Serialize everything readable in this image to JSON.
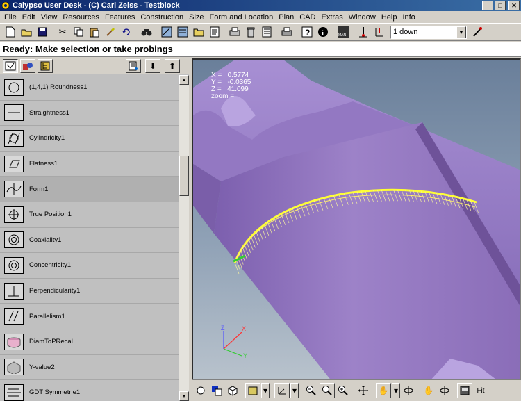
{
  "window": {
    "title": "Calypso User Desk - (C) Carl Zeiss - Testblock",
    "controls": {
      "minimize": "_",
      "maximize": "□",
      "close": "✕"
    }
  },
  "menu": [
    "File",
    "Edit",
    "View",
    "Resources",
    "Features",
    "Construction",
    "Size",
    "Form and Location",
    "Plan",
    "CAD",
    "Extras",
    "Window",
    "Help",
    "Info"
  ],
  "toolbar": {
    "icons": [
      "new-icon",
      "open-icon",
      "save-icon",
      "cut-icon",
      "copy-icon",
      "paste-icon",
      "brush-icon",
      "undo-icon",
      "binoculars-icon",
      "wizard-icon",
      "wizard2-icon",
      "folder-icon",
      "print-icon",
      "delete-icon",
      "report-icon",
      "printer2-icon",
      "help-icon",
      "info-icon",
      "manual-icon",
      "probe-icon",
      "probe-axis-icon"
    ],
    "combo_value": "1 down"
  },
  "status": "Ready: Make selection or take probings",
  "features": [
    {
      "label": "(1,4,1) Roundness1",
      "icon": "roundness-icon"
    },
    {
      "label": "Straightness1",
      "icon": "straightness-icon"
    },
    {
      "label": "Cylindricity1",
      "icon": "cylindricity-icon"
    },
    {
      "label": "Flatness1",
      "icon": "flatness-icon"
    },
    {
      "label": "Form1",
      "icon": "form-icon",
      "selected": true
    },
    {
      "label": "True Position1",
      "icon": "true-position-icon"
    },
    {
      "label": "Coaxiality1",
      "icon": "coaxiality-icon"
    },
    {
      "label": "Concentricity1",
      "icon": "concentricity-icon"
    },
    {
      "label": "Perpendicularity1",
      "icon": "perpendicularity-icon"
    },
    {
      "label": "Parallelism1",
      "icon": "parallelism-icon"
    },
    {
      "label": "DiamToPRecal",
      "icon": "diameter-icon"
    },
    {
      "label": "Y-value2",
      "icon": "y-value-icon"
    },
    {
      "label": "GDT Symmetrie1",
      "icon": "symmetry-icon"
    }
  ],
  "viewport": {
    "coords": {
      "x_label": "X =",
      "x_value": "0.5774",
      "y_label": "Y =",
      "y_value": "-0.0365",
      "z_label": "Z =",
      "z_value": "41.099",
      "zoom_label": "zoom ="
    },
    "triad": {
      "x": "X",
      "y": "Y",
      "z": "Z"
    },
    "colors": {
      "part": "#9a7fc6",
      "probe_points": "#ffff33",
      "background_top": "#6a7f9a"
    }
  },
  "viewtools": {
    "fit_label": "Fit"
  }
}
